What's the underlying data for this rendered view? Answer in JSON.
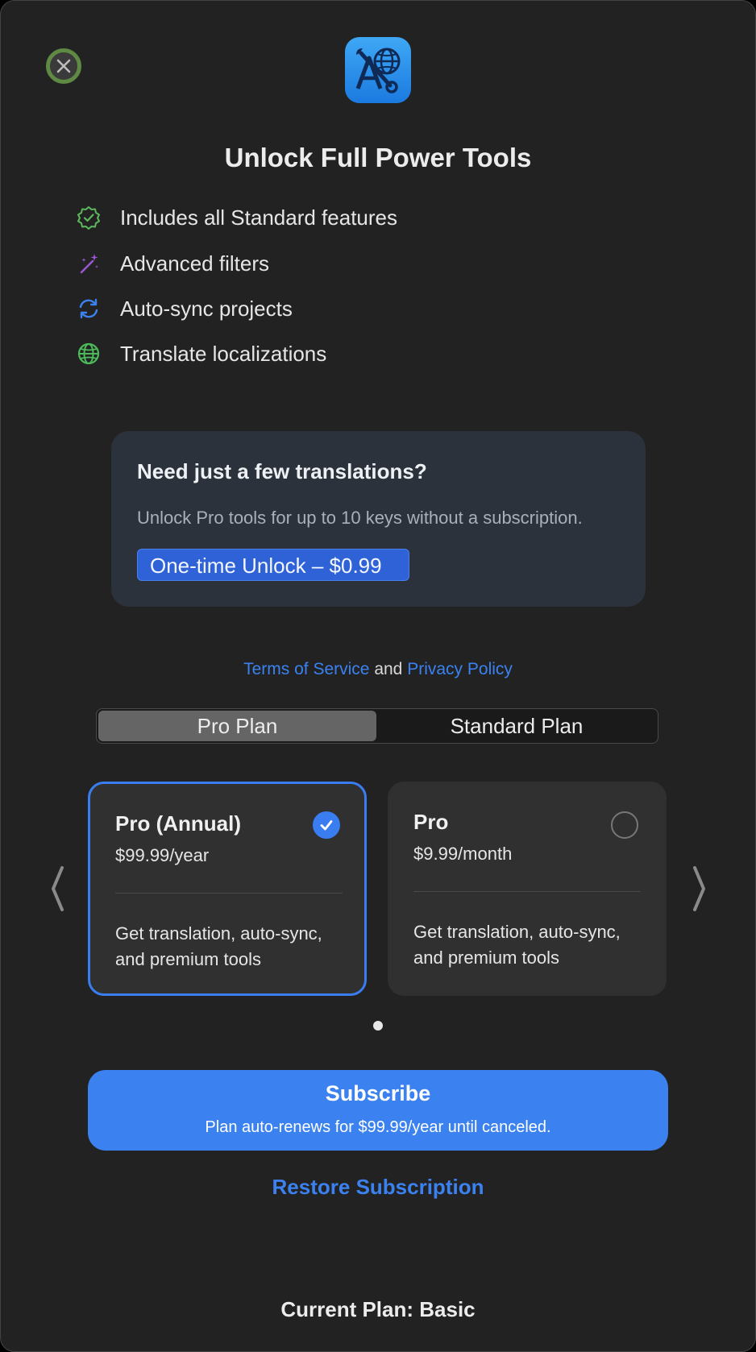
{
  "window": {
    "title": "Unlock Full Power Tools"
  },
  "features": [
    {
      "icon": "checkmark-seal-icon",
      "label": "Includes all Standard features",
      "color": "#5cb85c"
    },
    {
      "icon": "magic-wand-icon",
      "label": "Advanced filters",
      "color": "#9b59d6"
    },
    {
      "icon": "sync-arrows-icon",
      "label": "Auto-sync projects",
      "color": "#3b82f0"
    },
    {
      "icon": "globe-icon",
      "label": "Translate localizations",
      "color": "#4cbb5a"
    }
  ],
  "promo": {
    "title": "Need just a few translations?",
    "description": "Unlock Pro tools for up to 10 keys without a subscription.",
    "button_label": "One-time Unlock – $0.99"
  },
  "legal": {
    "terms": "Terms of Service",
    "and": "and",
    "privacy": "Privacy Policy"
  },
  "plan_tabs": [
    {
      "label": "Pro Plan",
      "selected": true
    },
    {
      "label": "Standard Plan",
      "selected": false
    }
  ],
  "plans": [
    {
      "name": "Pro (Annual)",
      "price": "$99.99/year",
      "description": "Get translation, auto-sync, and premium tools",
      "selected": true
    },
    {
      "name": "Pro",
      "price": "$9.99/month",
      "description": "Get translation, auto-sync, and premium tools",
      "selected": false
    }
  ],
  "pagination": {
    "current": 1,
    "total": 1
  },
  "subscribe": {
    "title": "Subscribe",
    "subtitle": "Plan auto-renews for $99.99/year until canceled."
  },
  "restore_label": "Restore Subscription",
  "current_plan": "Current Plan: Basic",
  "colors": {
    "accent": "#3b82f0",
    "background": "#222222",
    "card": "#303030",
    "promo_bg": "#2b323b",
    "close_ring": "#5e8a43"
  }
}
